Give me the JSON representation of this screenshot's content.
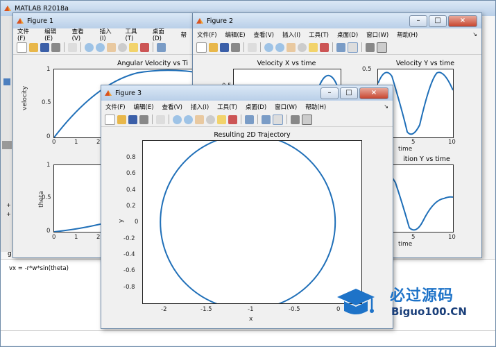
{
  "matlab": {
    "title": "MATLAB R2018a",
    "cmd_text": "vx = -r*w*sin(theta)",
    "left_marks": [
      "+",
      "+"
    ],
    "g_text": "g"
  },
  "menu_items": [
    "文件(F)",
    "编辑(E)",
    "查看(V)",
    "插入(I)",
    "工具(T)",
    "桌面(D)",
    "窗口(W)",
    "帮助(H)"
  ],
  "figure1": {
    "title": "Figure 1",
    "partial_menu": "帮",
    "ax1_title": "Angular Velocity vs Ti",
    "ax1_ylabel": "velocity",
    "ax2_ylabel": "theta"
  },
  "figure2": {
    "title": "Figure 2",
    "ax1_title": "Velocity X vs time",
    "ax2_title": "Velocity Y vs time",
    "ax3_title": "ition Y vs time",
    "xlabel": "time",
    "partial_tick": "0.5"
  },
  "figure3": {
    "title": "Figure 3",
    "ax_title": "Resulting 2D Trajectory",
    "xlabel": "x",
    "ylabel": "y"
  },
  "watermark": {
    "cn": "必过源码",
    "en": "Biguo100.CN"
  },
  "colors": {
    "line": "#1f6fb8",
    "title_bar": "#c9dbf0",
    "close": "#c7452f",
    "watermark": "#1e73c8"
  },
  "chart_data": [
    {
      "type": "line",
      "title": "Angular Velocity vs Ti",
      "ylabel": "velocity",
      "xlim": [
        0,
        10
      ],
      "ylim": [
        0,
        1
      ],
      "xticks": [
        "0",
        "1",
        "2"
      ],
      "yticks": [
        "0",
        "0.5",
        "1"
      ],
      "x": [
        0,
        1,
        2,
        3,
        4,
        5
      ],
      "y": [
        0,
        0.33,
        0.6,
        0.8,
        0.93,
        0.99
      ]
    },
    {
      "type": "line",
      "ylabel": "theta",
      "xlim": [
        0,
        10
      ],
      "ylim": [
        0,
        1
      ],
      "xticks": [
        "0",
        "1",
        "2"
      ],
      "yticks": [
        "0",
        "0.5",
        "1"
      ],
      "x": [
        0,
        1,
        2,
        3,
        4
      ],
      "y": [
        0,
        0.02,
        0.06,
        0.13,
        0.22
      ]
    },
    {
      "type": "line",
      "title": "Velocity Y vs time",
      "xlabel": "time",
      "xlim": [
        0,
        10
      ],
      "ylim": [
        -1,
        0.5
      ],
      "xticks": [
        "5",
        "10"
      ],
      "yticks": [
        "0.5"
      ],
      "x": [
        3.5,
        4,
        5,
        6,
        6.5,
        7,
        8,
        9,
        10
      ],
      "y": [
        0.3,
        0.5,
        -0.2,
        -0.9,
        -1.0,
        -0.7,
        0.1,
        0.4,
        0
      ]
    },
    {
      "type": "line",
      "title": "ition Y vs time",
      "xlabel": "time",
      "xlim": [
        0,
        10
      ],
      "xticks": [
        "5",
        "10"
      ],
      "x": [
        3.5,
        5,
        6.5,
        7.5,
        8.5,
        9.5,
        10
      ],
      "y": [
        0.7,
        0.35,
        0,
        -0.9,
        -0.4,
        0.1,
        0.2
      ]
    },
    {
      "type": "line",
      "title": "Resulting 2D Trajectory",
      "xlabel": "x",
      "ylabel": "y",
      "xlim": [
        -2.2,
        0.3
      ],
      "ylim": [
        -1,
        1
      ],
      "xticks": [
        "-2",
        "-1.5",
        "-1",
        "-0.5",
        "0"
      ],
      "yticks": [
        "0.8",
        "0.6",
        "0.4",
        "0.2",
        "0",
        "-0.2",
        "-0.4",
        "-0.6",
        "-0.8"
      ],
      "circle": {
        "cx": -1,
        "cy": 0,
        "r": 1
      }
    }
  ]
}
